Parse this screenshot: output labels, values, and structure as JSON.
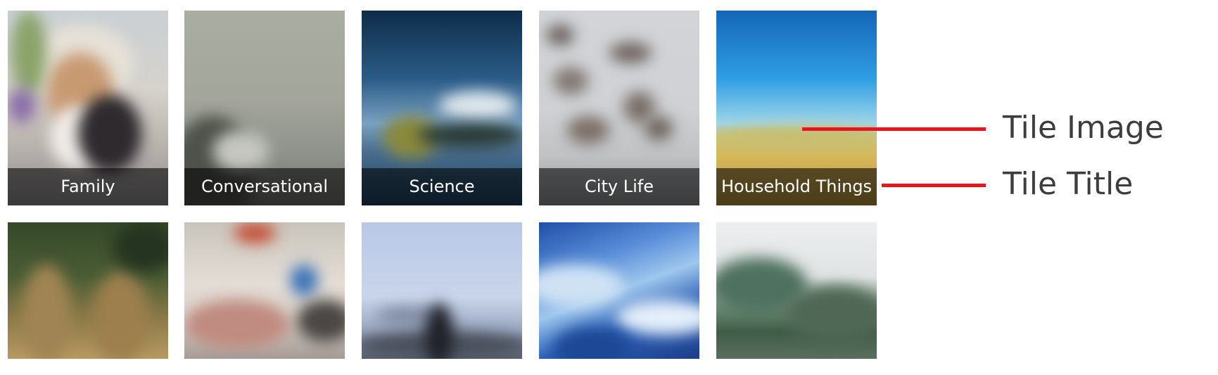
{
  "tiles": [
    {
      "title": "Family",
      "image": "family-photo"
    },
    {
      "title": "Conversational",
      "image": "foggy-cliff-photo"
    },
    {
      "title": "Science",
      "image": "lake-tree-photo"
    },
    {
      "title": "City Life",
      "image": "birds-sky-photo"
    },
    {
      "title": "Household Things",
      "image": "field-sky-photo"
    },
    {
      "title": "",
      "image": "grass-photo"
    },
    {
      "title": "",
      "image": "typing-hands-photo"
    },
    {
      "title": "",
      "image": "person-sky-photo"
    },
    {
      "title": "",
      "image": "ocean-wave-photo"
    },
    {
      "title": "",
      "image": "tree-fog-photo"
    }
  ],
  "annotations": {
    "tile_image_label": "Tile Image",
    "tile_title_label": "Tile Title",
    "line_color": "#e8151b"
  }
}
